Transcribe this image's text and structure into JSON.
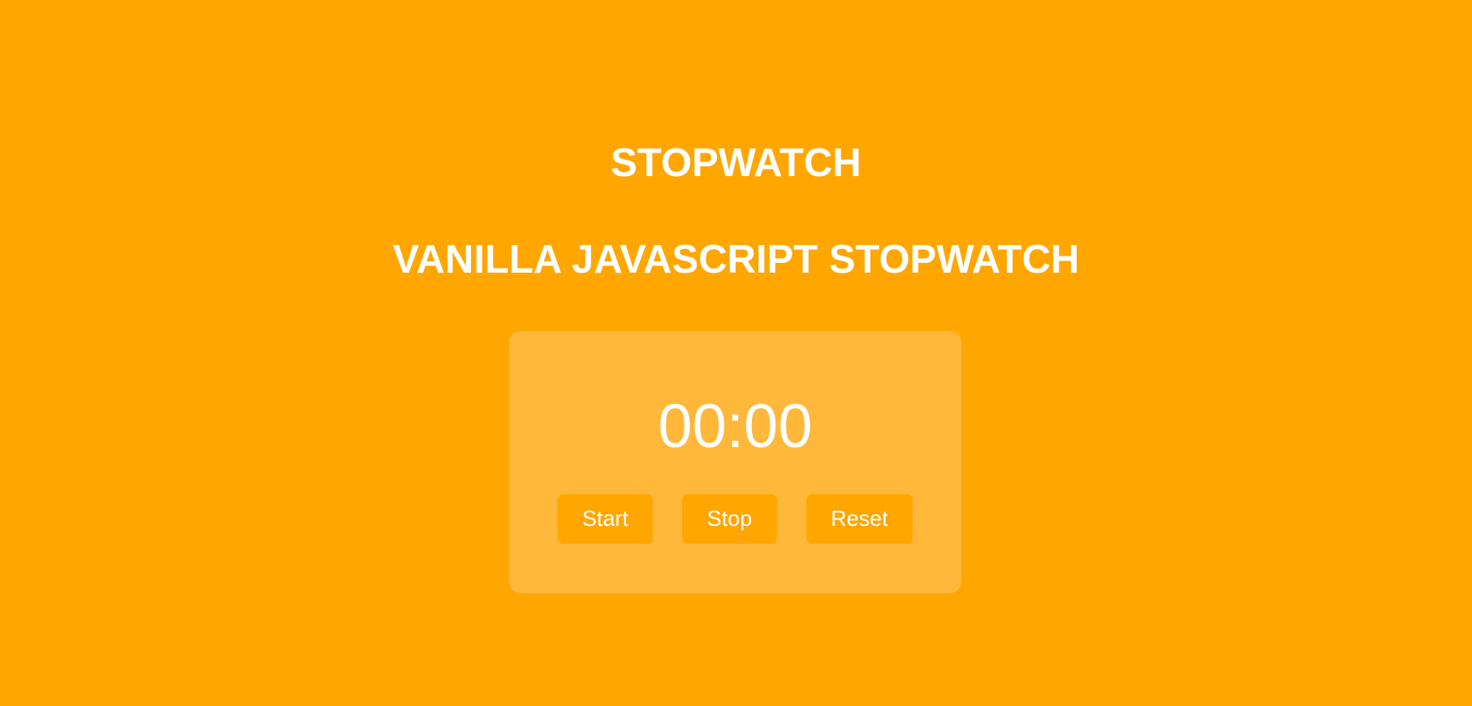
{
  "header": {
    "title": "STOPWATCH",
    "subtitle": "VANILLA JAVASCRIPT STOPWATCH"
  },
  "stopwatch": {
    "display": "00:00",
    "buttons": {
      "start_label": "Start",
      "stop_label": "Stop",
      "reset_label": "Reset"
    }
  },
  "colors": {
    "background": "#FFA600",
    "panel": "#FFB83A",
    "text": "#FFFFFF"
  }
}
